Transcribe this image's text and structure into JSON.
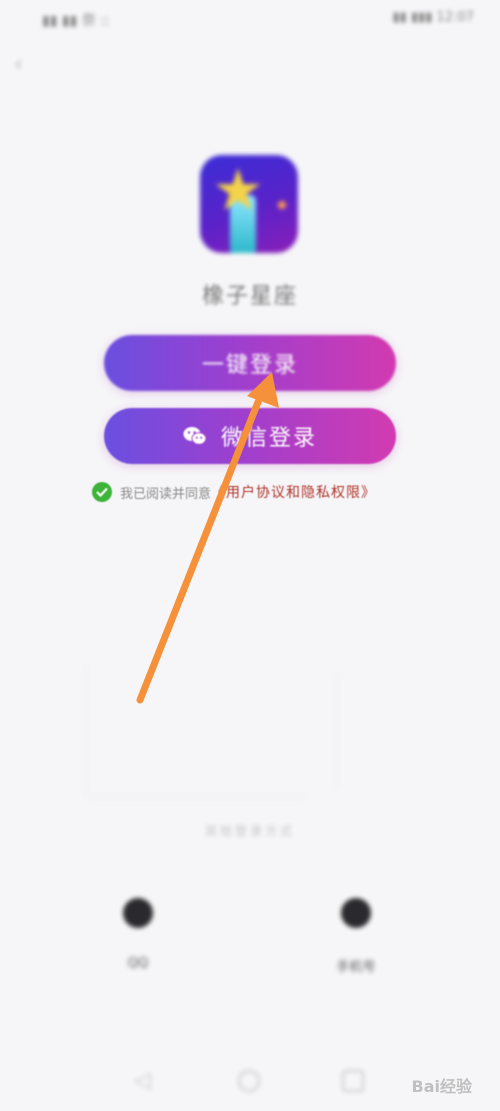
{
  "status_bar": {
    "left_text": "▮▮ ▮▮ 奈 ::",
    "right_text": "▮▮ ▮▮▮ 12:07"
  },
  "app": {
    "name": "橡子星座",
    "icon": "star-app-icon"
  },
  "buttons": {
    "quick_login": "一键登录",
    "wechat_login": "微信登录"
  },
  "agreement": {
    "prefix": "我已阅读并同意",
    "link": "《用户协议和隐私权限》",
    "checked": true
  },
  "other_login": {
    "title": "其他登录方式",
    "options": [
      {
        "label": "QQ",
        "icon": "qq-icon"
      },
      {
        "label": "手机号",
        "icon": "phone-icon"
      }
    ]
  },
  "navigation": {
    "icons": [
      "back-icon",
      "home-icon",
      "recent-apps-icon"
    ]
  },
  "watermark": "Bai经验",
  "colors": {
    "button_gradient_start": "#6a4fe0",
    "button_gradient_end": "#d23ab0",
    "check_green": "#3db33a",
    "link_red": "#b1352b",
    "arrow_orange": "#f5913a"
  }
}
